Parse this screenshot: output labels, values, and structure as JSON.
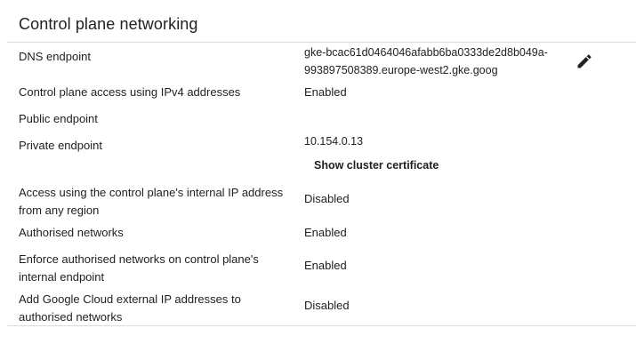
{
  "section": {
    "title": "Control plane networking",
    "show_certificate_label": "Show cluster certificate",
    "edit_icon": "pencil-icon"
  },
  "rows": [
    {
      "label": "DNS endpoint",
      "value_lines": [
        "gke-bcac61d0464046afabb6ba0333de2d8b049a-",
        "993897508389.europe-west2.gke.goog"
      ]
    },
    {
      "label": "Control plane access using IPv4 addresses",
      "value": "Enabled"
    },
    {
      "label": "Public endpoint",
      "value": ""
    },
    {
      "label": "Private endpoint",
      "value": "10.154.0.13"
    },
    {
      "label_lines": [
        "Access using the control plane's internal IP address",
        "from any region"
      ],
      "value": "Disabled"
    },
    {
      "label": "Authorised networks",
      "value": "Enabled"
    },
    {
      "label_lines": [
        "Enforce authorised networks on control plane's",
        "internal endpoint"
      ],
      "value": "Enabled"
    },
    {
      "label_lines": [
        "Add Google Cloud external IP addresses to",
        "authorised networks"
      ],
      "value": "Disabled"
    }
  ]
}
